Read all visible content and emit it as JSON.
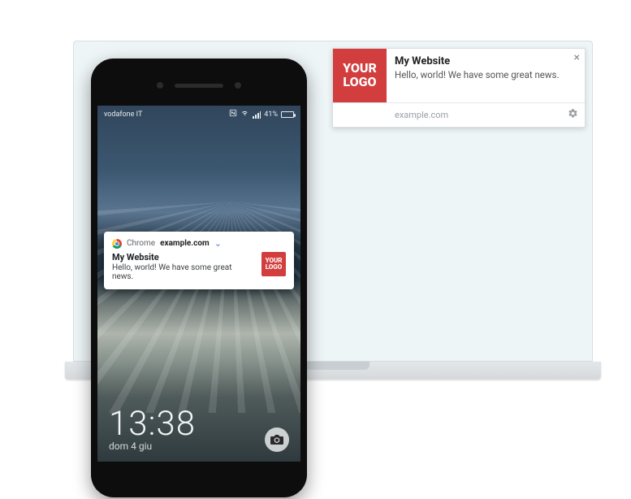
{
  "logo_text": "YOUR\nLOGO",
  "desktop_notification": {
    "title": "My Website",
    "body": "Hello, world! We have some great news.",
    "domain": "example.com"
  },
  "mobile": {
    "status": {
      "carrier": "vodafone IT",
      "battery_pct": "41%"
    },
    "notification": {
      "app": "Chrome",
      "domain": "example.com",
      "title": "My Website",
      "body": "Hello, world! We have some great news."
    },
    "lockscreen": {
      "time": "13:38",
      "date": "dom 4 giu"
    }
  }
}
